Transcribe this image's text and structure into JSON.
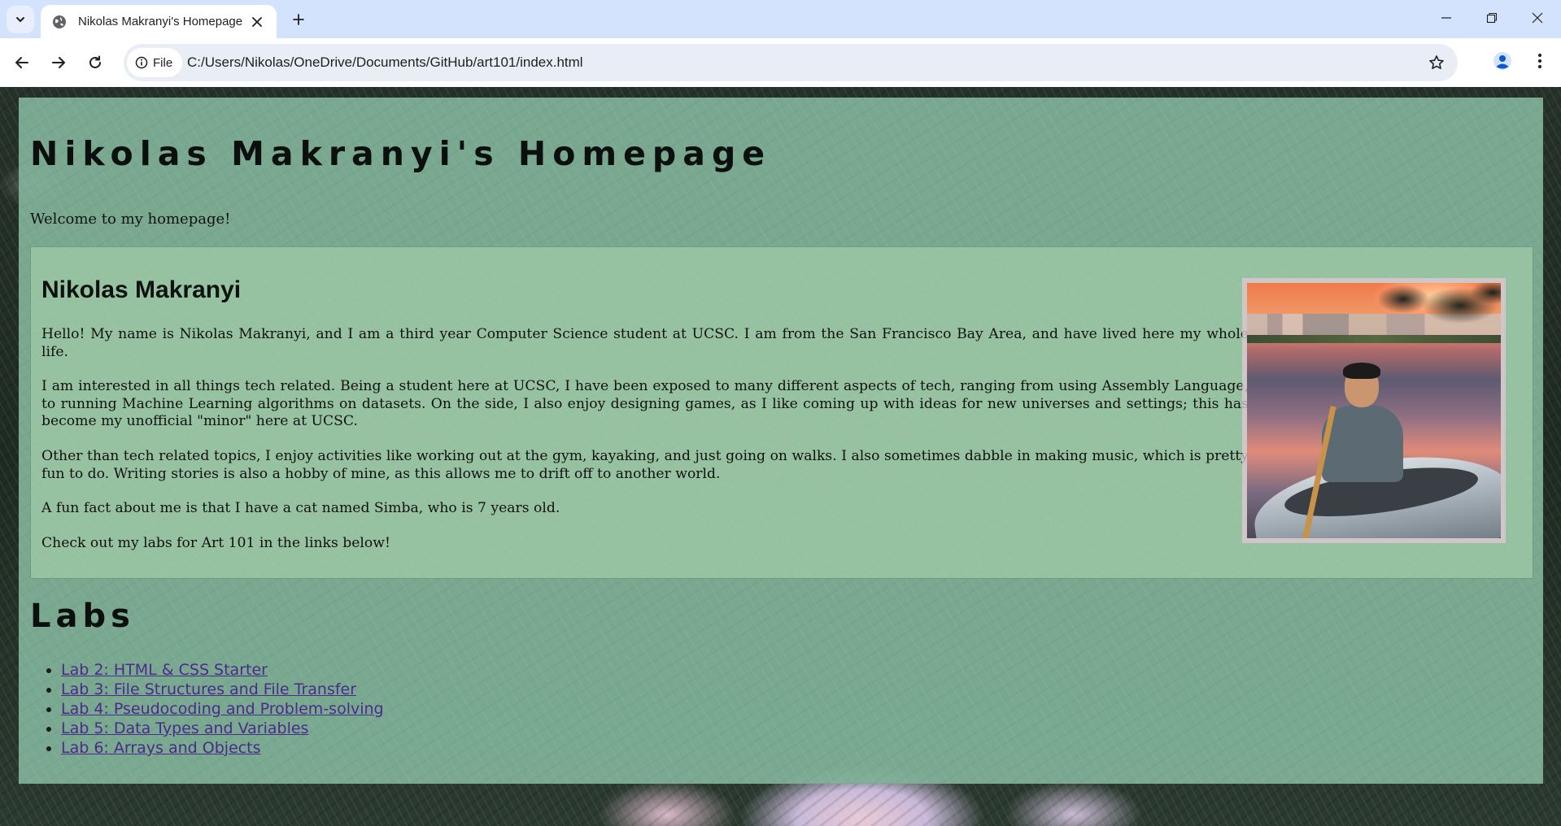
{
  "browser": {
    "tab_title": "Nikolas Makranyi's Homepage",
    "chip_label": "File",
    "url": "C:/Users/Nikolas/OneDrive/Documents/GitHub/art101/index.html"
  },
  "page": {
    "title": "Nikolas Makranyi's Homepage",
    "welcome": "Welcome to my homepage!",
    "bio": {
      "name": "Nikolas Makranyi",
      "paragraphs": [
        "Hello! My name is Nikolas Makranyi, and I am a third year Computer Science student at UCSC. I am from the San Francisco Bay Area, and have lived here my whole life.",
        "I am interested in all things tech related. Being a student here at UCSC, I have been exposed to many different aspects of tech, ranging from using Assembly Language, to running Machine Learning algorithms on datasets. On the side, I also enjoy designing games, as I like coming up with ideas for new universes and settings; this has become my unofficial \"minor\" here at UCSC.",
        "Other than tech related topics, I enjoy activities like working out at the gym, kayaking, and just going on walks. I also sometimes dabble in making music, which is pretty fun to do. Writing stories is also a hobby of mine, as this allows me to drift off to another world.",
        "A fun fact about me is that I have a cat named Simba, who is 7 years old.",
        "Check out my labs for Art 101 in the links below!"
      ]
    },
    "labs": {
      "title": "Labs",
      "items": [
        "Lab 2: HTML & CSS Starter",
        "Lab 3: File Structures and File Transfer",
        "Lab 4: Pseudocoding and Problem-solving",
        "Lab 5: Data Types and Variables",
        "Lab 6: Arrays and Objects"
      ]
    }
  }
}
